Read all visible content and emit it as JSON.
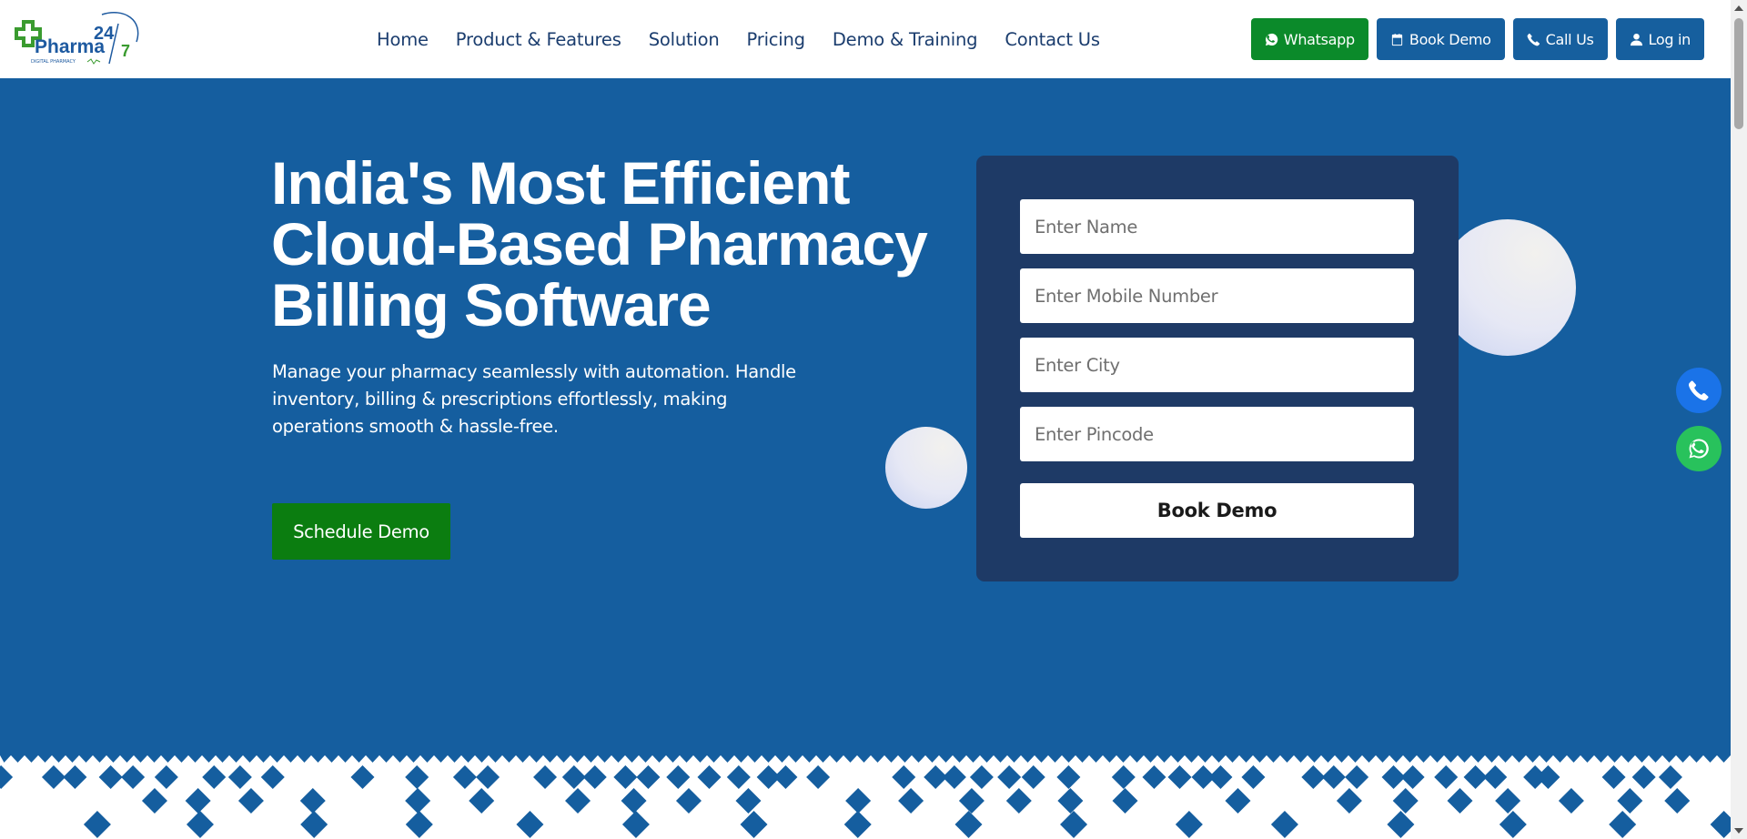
{
  "header": {
    "logo_alt": "Pharma24/7 Digital Pharmacy",
    "logo_text": "Pharma",
    "logo_numbers_top": "24",
    "logo_numbers_bottom": "7",
    "logo_tagline": "DIGITAL PHARMACY",
    "nav": [
      {
        "label": "Home"
      },
      {
        "label": "Product & Features"
      },
      {
        "label": "Solution"
      },
      {
        "label": "Pricing"
      },
      {
        "label": "Demo & Training"
      },
      {
        "label": "Contact Us"
      }
    ],
    "buttons": {
      "whatsapp": "Whatsapp",
      "book_demo": "Book Demo",
      "call_us": "Call Us",
      "login": "Log in"
    }
  },
  "hero": {
    "title_line1": "India's Most Efficient",
    "title_line2": "Cloud-Based Pharmacy",
    "title_line3": "Billing Software",
    "subtitle_line1": "Manage your pharmacy seamlessly with automation. Handle",
    "subtitle_line2": "inventory, billing & prescriptions effortlessly, making",
    "subtitle_line3": "operations smooth & hassle-free.",
    "cta": "Schedule Demo"
  },
  "form": {
    "name_placeholder": "Enter Name",
    "mobile_placeholder": "Enter Mobile Number",
    "city_placeholder": "Enter City",
    "pincode_placeholder": "Enter Pincode",
    "submit": "Book Demo"
  },
  "colors": {
    "header_bg": "#ffffff",
    "hero_bg": "#155e9f",
    "form_bg": "#1e3a66",
    "whatsapp_green": "#0b8a2a",
    "cta_green": "#0b7d10",
    "nav_text": "#1b3d6e",
    "fab_phone": "#1a73e8",
    "fab_whatsapp": "#28c25c"
  },
  "floating": {
    "phone_icon": "phone-icon",
    "whatsapp_icon": "whatsapp-icon"
  }
}
